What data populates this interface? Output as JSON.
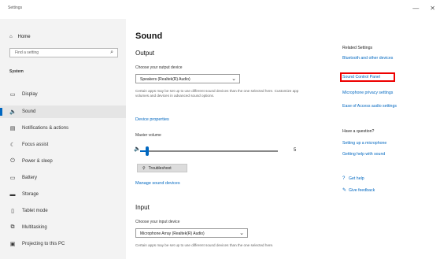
{
  "window": {
    "title": "Settings",
    "controls": [
      "—",
      "✕"
    ]
  },
  "sidebar": {
    "home_label": "Home",
    "search_placeholder": "Find a setting",
    "section_label": "System",
    "items": [
      {
        "label": "Display",
        "icon": "monitor-icon"
      },
      {
        "label": "Sound",
        "icon": "speaker-icon",
        "active": true
      },
      {
        "label": "Notifications & actions",
        "icon": "notification-icon"
      },
      {
        "label": "Focus assist",
        "icon": "moon-icon"
      },
      {
        "label": "Power & sleep",
        "icon": "power-icon"
      },
      {
        "label": "Battery",
        "icon": "battery-icon"
      },
      {
        "label": "Storage",
        "icon": "storage-icon"
      },
      {
        "label": "Tablet mode",
        "icon": "tablet-icon"
      },
      {
        "label": "Multitasking",
        "icon": "multitask-icon"
      },
      {
        "label": "Projecting to this PC",
        "icon": "project-icon"
      }
    ]
  },
  "main": {
    "title": "Sound",
    "output": {
      "heading": "Output",
      "device_label": "Choose your output device",
      "device_value": "Speakers (Realtek(R) Audio)",
      "description": "Certain apps may be set up to use different sound devices than the one selected here. Customize app volumes and devices in advanced sound options.",
      "properties_link": "Device properties",
      "volume_label": "Master volume",
      "volume_value": "5",
      "volume_fraction": 0.05,
      "troubleshoot_label": "Troubleshoot",
      "manage_link": "Manage sound devices"
    },
    "input": {
      "heading": "Input",
      "device_label": "Choose your input device",
      "device_value": "Microphone Array (Realtek(R) Audio)",
      "description": "Certain apps may be set up to use different sound devices than the one selected here."
    }
  },
  "related": {
    "heading": "Related Settings",
    "links": [
      "Bluetooth and other devices",
      "Sound Control Panel",
      "Microphone privacy settings",
      "Ease of Access audio settings"
    ],
    "question_heading": "Have a question?",
    "question_links": [
      "Setting up a microphone",
      "Getting help with sound"
    ],
    "help_links": [
      {
        "label": "Get help",
        "icon": "help-icon"
      },
      {
        "label": "Give feedback",
        "icon": "feedback-icon"
      }
    ]
  },
  "accent_color": "#0067c0",
  "highlight_color": "#e00000"
}
